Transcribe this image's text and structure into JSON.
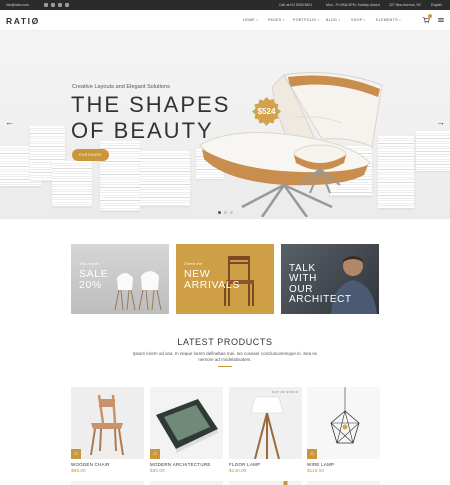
{
  "topbar": {
    "email": "info@ratio.com",
    "phone": "Call us+01 8940 5501",
    "hours": "Mon - Fri 9AM-5PM, Sunday closed",
    "address": "227 New Avenue, NY",
    "language": "English"
  },
  "header": {
    "logo": "RATIØ",
    "nav": [
      {
        "label": "HOME"
      },
      {
        "label": "PAGES"
      },
      {
        "label": "PORTFOLIO"
      },
      {
        "label": "BLOG"
      },
      {
        "label": "SHOP"
      },
      {
        "label": "ELEMENTS"
      }
    ],
    "icons": [
      "cart-icon",
      "menu-icon"
    ]
  },
  "hero": {
    "subtitle": "Creative Layouts and Elegant Solutions",
    "title_line1": "THE SHAPES",
    "title_line2": "OF BEAUTY",
    "button": "PURCHASE",
    "price": "$524",
    "prev": "←",
    "next": "→",
    "slides": 3,
    "active_slide": 1
  },
  "promos": [
    {
      "small": "This month",
      "big_line1": "SALE",
      "big_line2": "20%",
      "bg": "#c9c9c9"
    },
    {
      "small": "Check the",
      "big_line1": "NEW",
      "big_line2": "ARRIVALS",
      "bg": "#cf9f45"
    },
    {
      "small": "",
      "big_line1": "TALK",
      "big_line2": "WITH",
      "big_line3": "OUR",
      "big_line4": "ARCHITECT",
      "bg": "#3a3f46"
    }
  ],
  "latest": {
    "title": "LATEST PRODUCTS",
    "description": "Ipsum lorem od sea. In neque lorem definebas mei. Ius cossaer conclusionemque in. Sea ex nemore ad modelatisatem.",
    "products": [
      {
        "name": "WOODEN CHAIR",
        "price": "$96.00"
      },
      {
        "name": "MODERN ARCHITECTURE",
        "price": "$30.00"
      },
      {
        "name": "FLOOR LAMP",
        "price": "$140.00",
        "badge": "OUT OF STOCK"
      },
      {
        "name": "WIRE LAMP",
        "price": "$119.00"
      }
    ]
  },
  "colors": {
    "accent": "#c9963a",
    "topbar": "#2b2b2b"
  }
}
